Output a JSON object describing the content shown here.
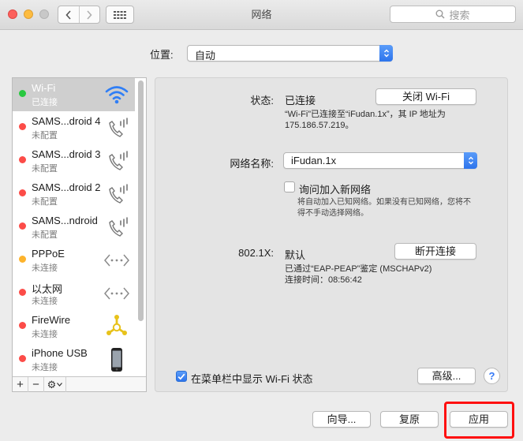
{
  "window": {
    "title": "网络"
  },
  "search": {
    "placeholder": "搜索"
  },
  "location": {
    "label": "位置:",
    "value": "自动"
  },
  "services": [
    {
      "name": "Wi-Fi",
      "status": "已连接",
      "status_color": "#28c840",
      "icon": "wifi-icon",
      "selected": true
    },
    {
      "name": "SAMS...droid 4",
      "status": "未配置",
      "status_color": "#fc4c48",
      "icon": "phone-icon"
    },
    {
      "name": "SAMS...droid 3",
      "status": "未配置",
      "status_color": "#fc4c48",
      "icon": "phone-icon"
    },
    {
      "name": "SAMS...droid 2",
      "status": "未配置",
      "status_color": "#fc4c48",
      "icon": "phone-icon"
    },
    {
      "name": "SAMS...ndroid",
      "status": "未配置",
      "status_color": "#fc4c48",
      "icon": "phone-icon"
    },
    {
      "name": "PPPoE",
      "status": "未连接",
      "status_color": "#fdb32c",
      "icon": "ethernet-arrows-icon"
    },
    {
      "name": "以太网",
      "status": "未连接",
      "status_color": "#fc4c48",
      "icon": "ethernet-arrows-icon"
    },
    {
      "name": "FireWire",
      "status": "未连接",
      "status_color": "#fc4c48",
      "icon": "firewire-icon"
    },
    {
      "name": "iPhone USB",
      "status": "未连接",
      "status_color": "#fc4c48",
      "icon": "iphone-icon"
    }
  ],
  "sidebar_footer": {
    "add": "+",
    "remove": "−",
    "gear": "⚙"
  },
  "details": {
    "status_label": "状态:",
    "status_value": "已连接",
    "turn_off_wifi": "关闭 Wi-Fi",
    "status_note_line1": "“Wi-Fi”已连接至“iFudan.1x”，其 IP 地址为",
    "status_note_line2": "175.186.57.219。",
    "network_name_label": "网络名称:",
    "network_name_value": "iFudan.1x",
    "ask_join_label": "询问加入新网络",
    "ask_join_note_line1": "将自动加入已知网络。如果没有已知网络，您将不",
    "ask_join_note_line2": "得不手动选择网络。",
    "dot1x_label": "802.1X:",
    "dot1x_value": "默认",
    "disconnect": "断开连接",
    "dot1x_note_line1": "已通过“EAP-PEAP”鉴定 (MSCHAPv2)",
    "dot1x_note_line2": "连接时间：08:56:42",
    "show_in_menubar": "在菜单栏中显示 Wi-Fi 状态",
    "advanced": "高级...",
    "help": "?"
  },
  "bottom_bar": {
    "assistant": "向导...",
    "revert": "复原",
    "apply": "应用"
  },
  "colors": {
    "accent": "#3478f6",
    "highlight_box": "#ff0f0f"
  }
}
